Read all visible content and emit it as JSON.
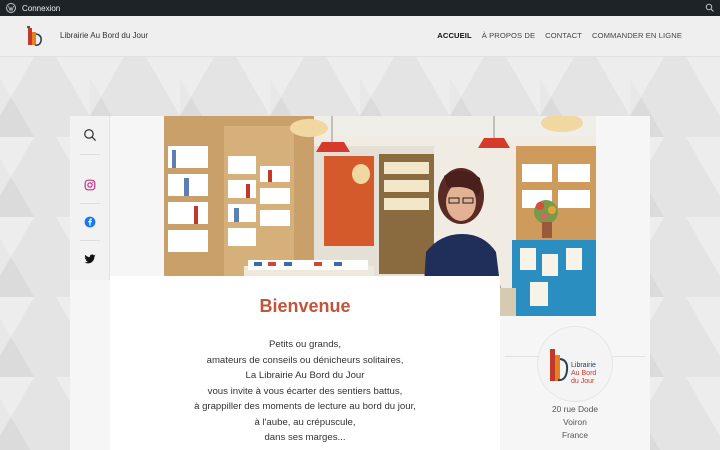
{
  "adminbar": {
    "login_label": "Connexion"
  },
  "header": {
    "site_title": "Librairie Au Bord du Jour",
    "nav": [
      "ACCUEIL",
      "À PROPOS DE",
      "CONTACT",
      "COMMANDER EN LIGNE"
    ]
  },
  "welcome": {
    "title": "Bienvenue",
    "lines": [
      "Petits ou grands,",
      "amateurs de conseils ou dénicheurs solitaires,",
      "La Librairie Au Bord du Jour",
      "vous invite à vous écarter des sentiers battus,",
      "à grappiller des moments de lecture au bord du jour,",
      "à l'aube, au crépuscule,",
      "dans ses marges..."
    ]
  },
  "badge": {
    "line1": "Librairie",
    "line2": "Au Bord",
    "line3": "du Jour"
  },
  "address": {
    "street": "20 rue Dode",
    "city": "Voiron",
    "country": "France"
  },
  "colors": {
    "accent": "#c0553b",
    "adminbar": "#1d2327",
    "instagram": "#c13584",
    "facebook": "#1877f2"
  },
  "icons": {
    "search": "search-icon",
    "instagram": "instagram-icon",
    "facebook": "facebook-icon",
    "twitter": "twitter-icon"
  }
}
